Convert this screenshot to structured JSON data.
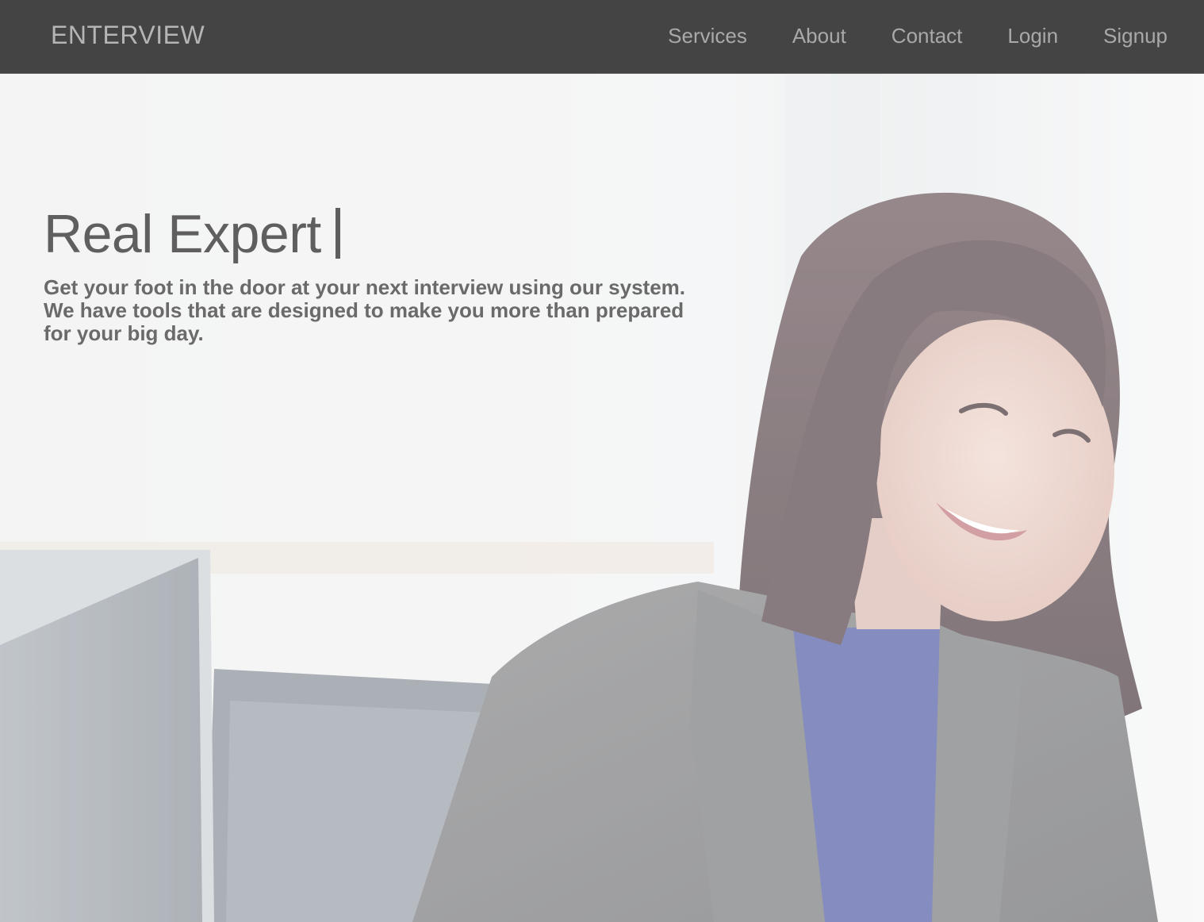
{
  "navbar": {
    "brand": "ENTERVIEW",
    "links": [
      {
        "label": "Services"
      },
      {
        "label": "About"
      },
      {
        "label": "Contact"
      },
      {
        "label": "Login"
      },
      {
        "label": "Signup"
      }
    ]
  },
  "hero": {
    "headline": "Real Expert",
    "tagline": "Get your foot in the door at your next interview using our system. We have tools that are designed to make you more than prepared for your big day.",
    "photo": "smiling-woman-office-photo"
  },
  "colors": {
    "navbar_bg": "#444444",
    "nav_text": "#a9a9a9",
    "headline_text": "#5f5f5f"
  }
}
